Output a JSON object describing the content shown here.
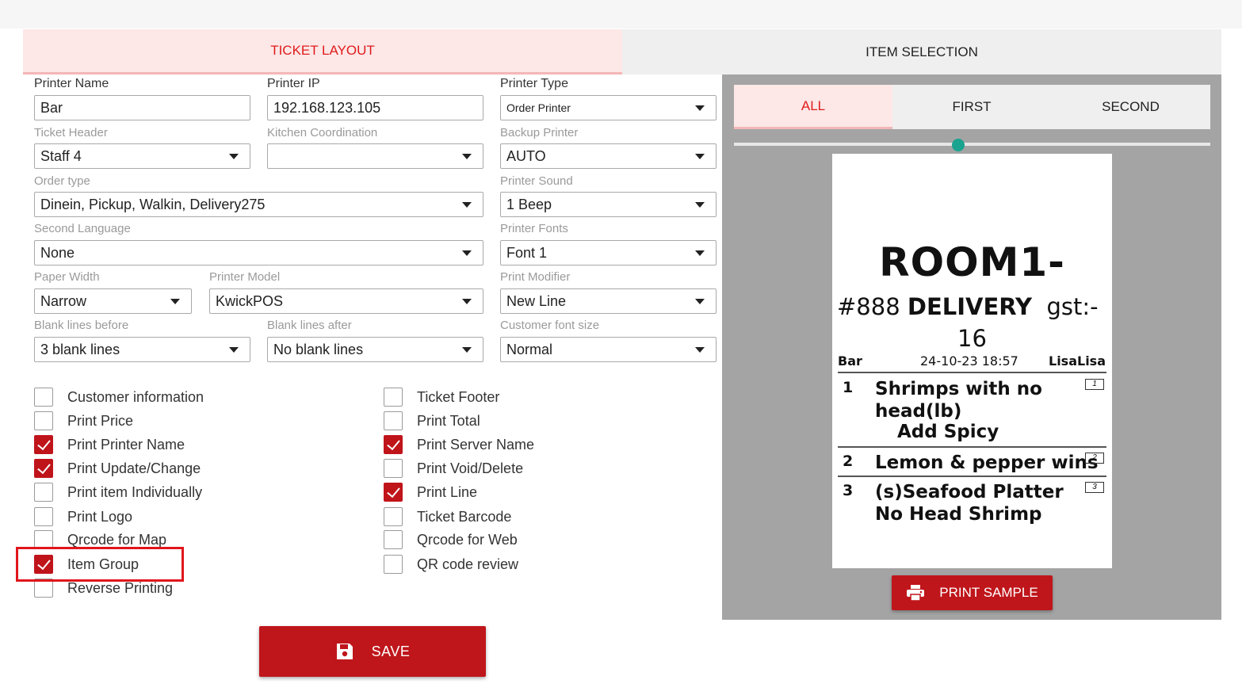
{
  "tabs": {
    "ticket_layout": "TICKET LAYOUT",
    "item_selection": "ITEM SELECTION"
  },
  "form": {
    "printer_name": {
      "label": "Printer Name",
      "value": "Bar"
    },
    "printer_ip": {
      "label": "Printer IP",
      "value": "192.168.123.105"
    },
    "printer_type": {
      "label": "Printer Type",
      "value": "Order Printer"
    },
    "ticket_header": {
      "label": "Ticket Header",
      "value": "Staff 4"
    },
    "kitchen_coordination": {
      "label": "Kitchen Coordination",
      "value": ""
    },
    "backup_printer": {
      "label": "Backup Printer",
      "value": "AUTO"
    },
    "order_type": {
      "label": "Order type",
      "value": "Dinein, Pickup, Walkin, Delivery275"
    },
    "printer_sound": {
      "label": "Printer Sound",
      "value": "1 Beep"
    },
    "second_language": {
      "label": "Second Language",
      "value": "None"
    },
    "printer_fonts": {
      "label": "Printer Fonts",
      "value": "Font 1"
    },
    "paper_width": {
      "label": "Paper Width",
      "value": "Narrow"
    },
    "printer_model": {
      "label": "Printer Model",
      "value": "KwickPOS"
    },
    "print_modifier": {
      "label": "Print Modifier",
      "value": "New Line"
    },
    "blank_lines_before": {
      "label": "Blank lines before",
      "value": "3 blank lines"
    },
    "blank_lines_after": {
      "label": "Blank lines after",
      "value": "No blank lines"
    },
    "customer_font_size": {
      "label": "Customer font size",
      "value": "Normal"
    }
  },
  "checkboxes_left": [
    {
      "label": "Customer information",
      "checked": false
    },
    {
      "label": "Print Price",
      "checked": false
    },
    {
      "label": "Print Printer Name",
      "checked": true
    },
    {
      "label": "Print Update/Change",
      "checked": true
    },
    {
      "label": "Print item Individually",
      "checked": false
    },
    {
      "label": "Print Logo",
      "checked": false
    },
    {
      "label": "Qrcode for Map",
      "checked": false
    },
    {
      "label": "Item Group",
      "checked": true
    },
    {
      "label": "Reverse Printing",
      "checked": false
    }
  ],
  "checkboxes_right": [
    {
      "label": "Ticket Footer",
      "checked": false
    },
    {
      "label": "Print Total",
      "checked": false
    },
    {
      "label": "Print Server Name",
      "checked": true
    },
    {
      "label": "Print Void/Delete",
      "checked": false
    },
    {
      "label": "Print Line",
      "checked": true
    },
    {
      "label": "Ticket Barcode",
      "checked": false
    },
    {
      "label": "Qrcode for Web",
      "checked": false
    },
    {
      "label": "QR code review",
      "checked": false
    }
  ],
  "save_button": {
    "label": "SAVE",
    "icon": "floppy-disk-icon"
  },
  "preview": {
    "subtabs": {
      "all": "ALL",
      "first": "FIRST",
      "second": "SECOND"
    },
    "ticket": {
      "room": "ROOM1-",
      "order_no": "#888",
      "order_type": "DELIVERY",
      "gst": "gst:-",
      "count": "16",
      "printer": "Bar",
      "datetime": "24-10-23 18:57",
      "server": "LisaLisa",
      "items": [
        {
          "qty": "1",
          "line1": "Shrimps with no",
          "line2": "head(lb)",
          "modifier": "Add Spicy",
          "tag": "1"
        },
        {
          "qty": "2",
          "line1": "Lemon & pepper wins",
          "tag": "2"
        },
        {
          "qty": "3",
          "line1": "(s)Seafood Platter",
          "line2": "No Head Shrimp",
          "tag": "3"
        }
      ]
    },
    "print_button": {
      "label": "PRINT SAMPLE",
      "icon": "printer-icon"
    }
  },
  "colors": {
    "accent": "#bf161b",
    "tab_active_bg": "#fde7e7",
    "tab_active_text": "#e01b1b",
    "panel_bg": "#a4a4a4",
    "slider_thumb": "#1aa38f"
  }
}
